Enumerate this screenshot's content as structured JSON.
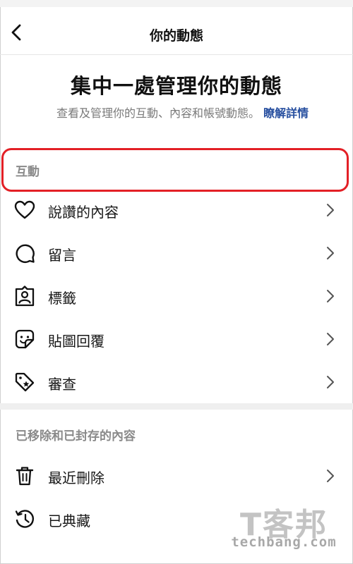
{
  "header": {
    "title": "你的動態"
  },
  "hero": {
    "title": "集中一處管理你的動態",
    "description": "查看及管理你的互動、內容和帳號動態。",
    "learn_more": "瞭解詳情"
  },
  "sections": {
    "interactions": {
      "label": "互動",
      "items": [
        {
          "label": "說讚的內容",
          "icon": "heart-icon"
        },
        {
          "label": "留言",
          "icon": "comment-icon"
        },
        {
          "label": "標籤",
          "icon": "tag-person-icon"
        },
        {
          "label": "貼圖回覆",
          "icon": "sticker-icon"
        },
        {
          "label": "審查",
          "icon": "review-tag-icon"
        }
      ]
    },
    "removed": {
      "label": "已移除和已封存的內容",
      "items": [
        {
          "label": "最近刪除",
          "icon": "trash-icon"
        },
        {
          "label": "已典藏",
          "icon": "archive-icon"
        }
      ]
    }
  },
  "annotation": {
    "color": "#e32026"
  },
  "watermark": {
    "brand": "T客邦",
    "site": "techbang.com"
  }
}
